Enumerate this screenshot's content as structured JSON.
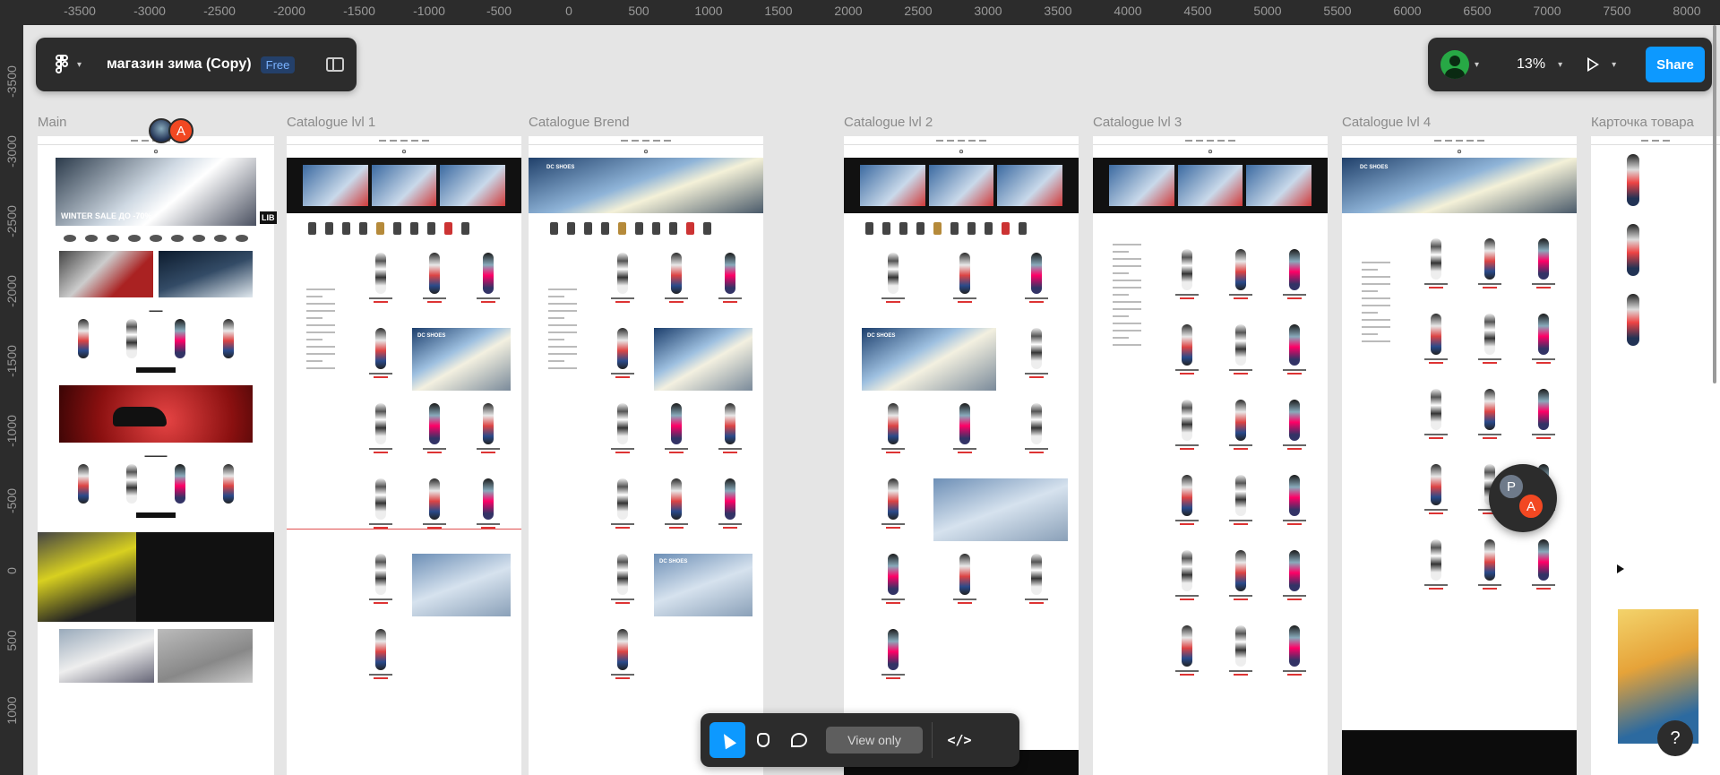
{
  "app": {
    "file_title": "магазин зима (Copy)",
    "plan_badge": "Free",
    "zoom": "13%",
    "share_label": "Share",
    "view_only_label": "View only",
    "help_label": "?",
    "dev_mode_label": "</>",
    "accent_color": "#0d99ff"
  },
  "ruler": {
    "top_ticks": [
      "-3500",
      "-3000",
      "-2500",
      "-2000",
      "-1500",
      "-1000",
      "-500",
      "0",
      "500",
      "1000",
      "1500",
      "2000",
      "2500",
      "3000",
      "3500",
      "4000",
      "4500",
      "5000",
      "5500",
      "6000",
      "6500",
      "7000",
      "7500",
      "8000"
    ],
    "left_ticks": [
      "-3500",
      "-3000",
      "-2500",
      "-2000",
      "-1500",
      "-1000",
      "-500",
      "0",
      "500",
      "1000"
    ]
  },
  "frames": [
    {
      "label": "Main"
    },
    {
      "label": "Catalogue lvl 1"
    },
    {
      "label": "Catalogue Brend"
    },
    {
      "label": "Catalogue lvl 2"
    },
    {
      "label": "Catalogue lvl 3"
    },
    {
      "label": "Catalogue lvl 4"
    },
    {
      "label": "Карточка товара"
    }
  ],
  "main_frame": {
    "hero_text": "WINTER SALE ДО -70%",
    "side_text": "LIB"
  },
  "collaborators": {
    "avatar_a": "A",
    "avatar_p": "P"
  },
  "brand_text": "DC SHOES"
}
